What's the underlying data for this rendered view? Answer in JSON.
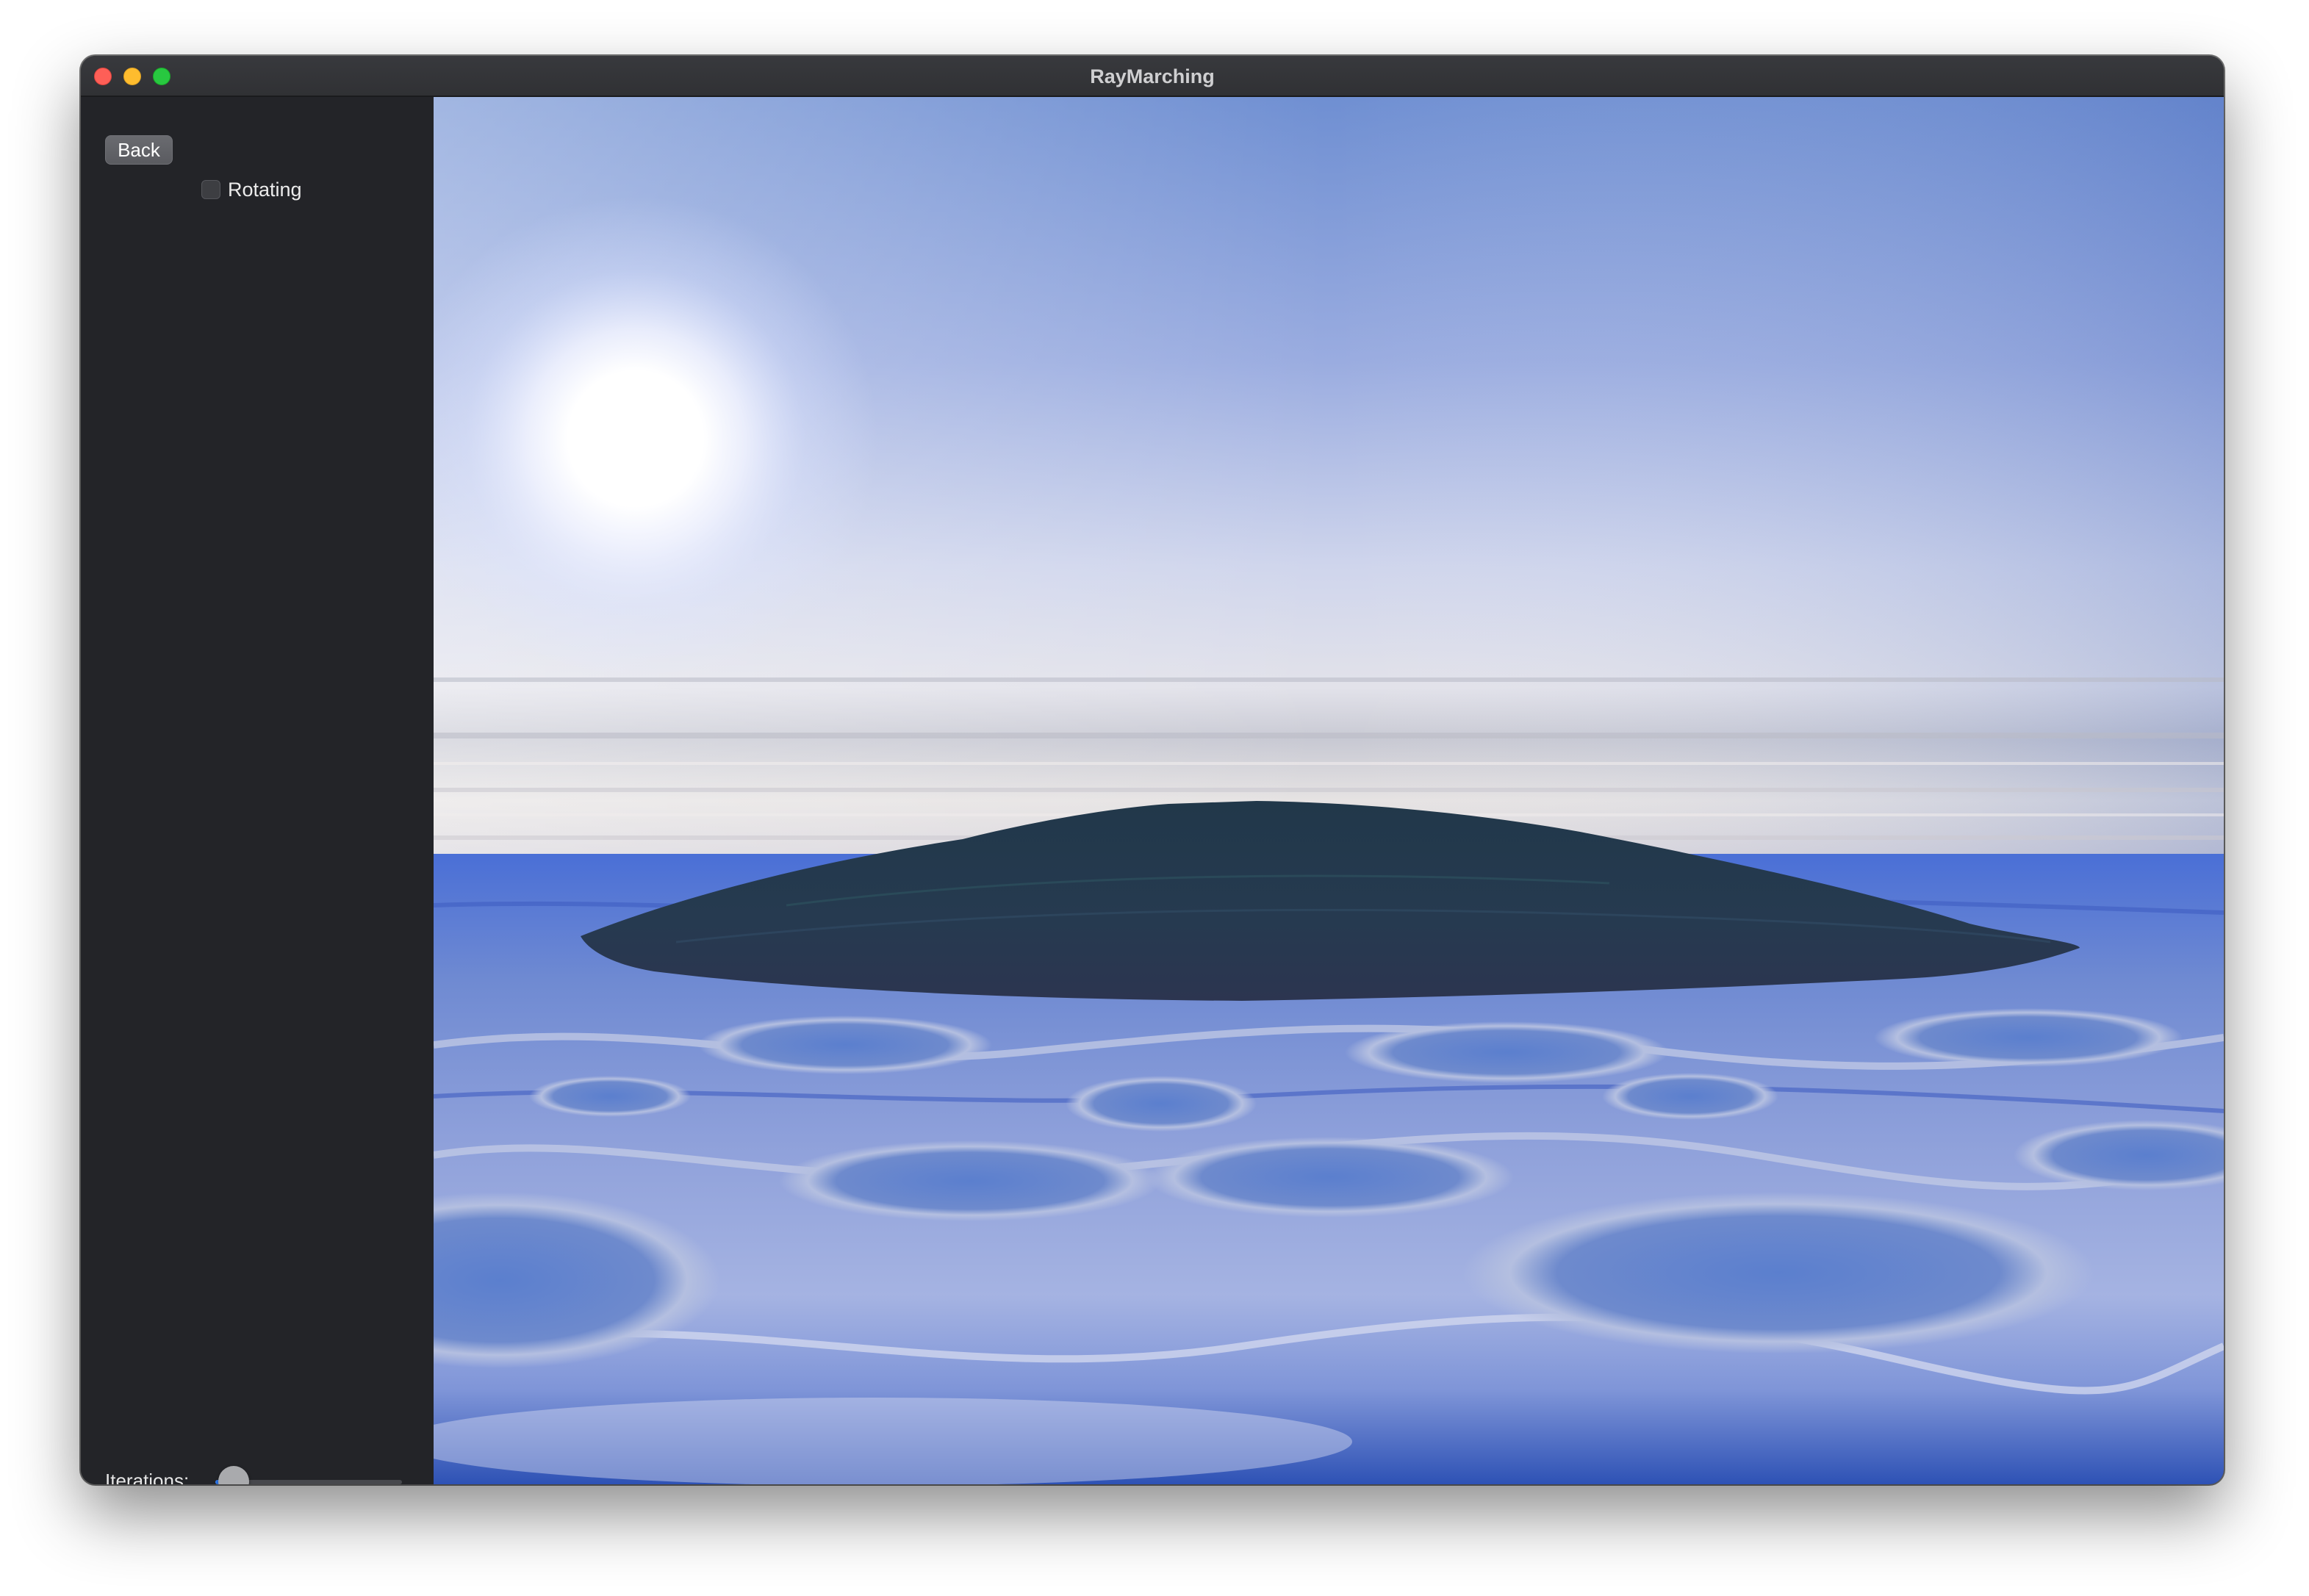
{
  "window": {
    "title": "RayMarching"
  },
  "sidebar": {
    "back_label": "Back",
    "rotating_label": "Rotating",
    "rotating_checked": false,
    "iterations_label": "Iterations:",
    "iterations_level": 0.1
  },
  "scene": {
    "description_icon": "raymarched-ocean-island-render",
    "sky_top_color": "#6a88cc",
    "sun_color": "#ffffff",
    "water_color": "#5c7fd4",
    "island_color": "#22364a"
  }
}
